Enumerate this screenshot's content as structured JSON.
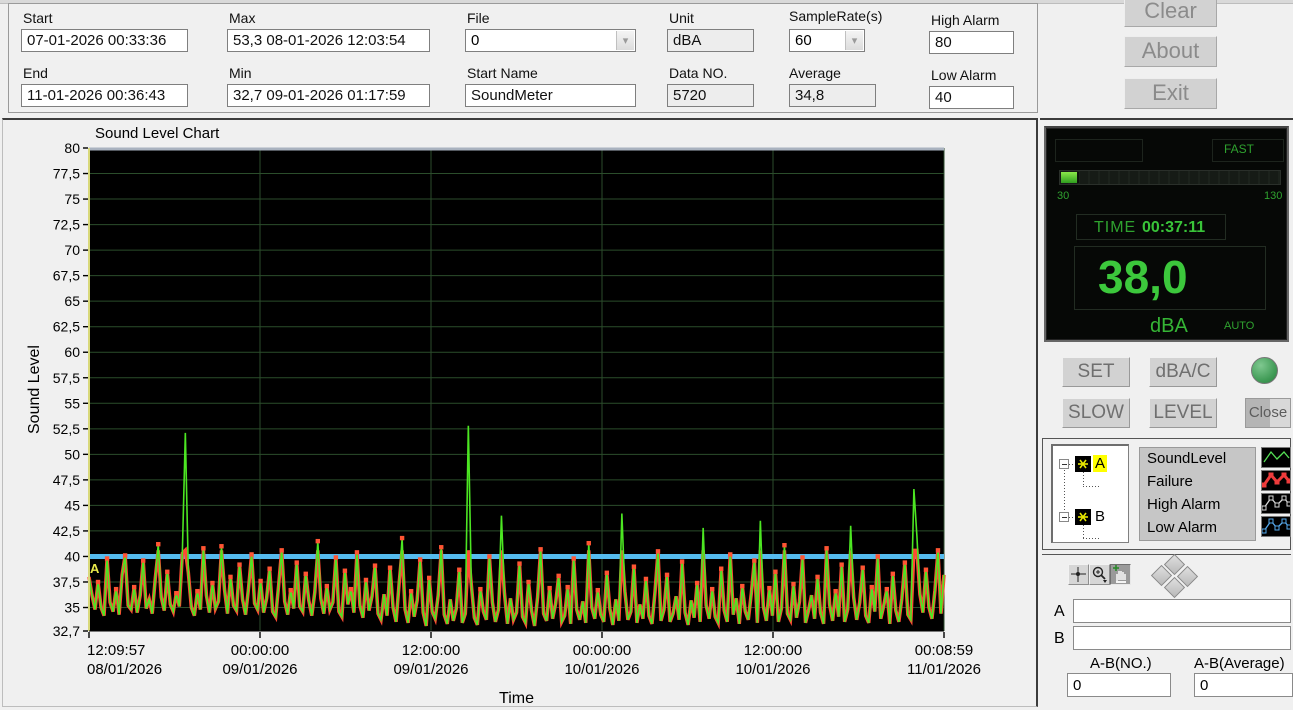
{
  "toolbar": {
    "start": {
      "label": "Start",
      "value": "07-01-2026 00:33:36"
    },
    "end": {
      "label": "End",
      "value": "11-01-2026 00:36:43"
    },
    "max": {
      "label": "Max",
      "value": "53,3 08-01-2026 12:03:54"
    },
    "min": {
      "label": "Min",
      "value": "32,7 09-01-2026 01:17:59"
    },
    "file": {
      "label": "File",
      "value": "0"
    },
    "start_name": {
      "label": "Start Name",
      "value": "SoundMeter"
    },
    "unit": {
      "label": "Unit",
      "value": "dBA"
    },
    "data_no": {
      "label": "Data NO.",
      "value": "5720"
    },
    "sample_rate": {
      "label": "SampleRate(s)",
      "value": "60"
    },
    "average": {
      "label": "Average",
      "value": "34,8"
    },
    "high_alarm": {
      "label": "High Alarm",
      "value": "80"
    },
    "low_alarm": {
      "label": "Low Alarm",
      "value": "40"
    },
    "buttons": {
      "clear": "Clear",
      "about": "About",
      "exit": "Exit"
    }
  },
  "meter": {
    "mode": "FAST",
    "bar": {
      "min": 30,
      "max": 130,
      "value": 38,
      "min_label": "30",
      "max_label": "130"
    },
    "time_label": "TIME",
    "time_value": "00:37:11",
    "value": "38,0",
    "unit": "dBA",
    "range_mode": "AUTO",
    "buttons": {
      "set": "SET",
      "dbac": "dBA/C",
      "slow": "SLOW",
      "level": "LEVEL",
      "close": "Close"
    }
  },
  "legend": {
    "tree": {
      "a": "A",
      "b": "B"
    },
    "items": [
      {
        "label": "SoundLevel",
        "color": "#55e055",
        "style": "plain"
      },
      {
        "label": "Failure",
        "color": "#ee3b3b",
        "style": "thick"
      },
      {
        "label": "High Alarm",
        "color": "#d8d8d8",
        "style": "open"
      },
      {
        "label": "Low Alarm",
        "color": "#55aaee",
        "style": "open"
      }
    ]
  },
  "analysis": {
    "a_label": "A",
    "b_label": "B",
    "a_value": "",
    "b_value": "",
    "ab_no": {
      "label": "A-B(NO.)",
      "value": "0"
    },
    "ab_avg": {
      "label": "A-B(Average)",
      "value": "0"
    }
  },
  "chart_data": {
    "type": "line",
    "title": "Sound Level Chart",
    "xlabel": "Time",
    "ylabel": "Sound Level",
    "ylim": [
      32.7,
      80
    ],
    "grid": true,
    "colors": {
      "plot_bg": "#000000",
      "grid": "#2b4d2b",
      "axis_left": "#d8d87a",
      "series": "#4ce622",
      "failure": "#ff4a33",
      "marker": "#ff5533",
      "low_alarm_line": "#55bbee",
      "high_alarm_line": "#a9b2bf",
      "cursor": "#e8e84a",
      "text": "#000000"
    },
    "low_alarm_value": 40,
    "high_alarm_value": 80,
    "cursor_a": {
      "label": "A",
      "index": 0
    },
    "y_ticks": [
      [
        80,
        "80"
      ],
      [
        77.5,
        "77,5"
      ],
      [
        75,
        "75"
      ],
      [
        72.5,
        "72,5"
      ],
      [
        70,
        "70"
      ],
      [
        67.5,
        "67,5"
      ],
      [
        65,
        "65"
      ],
      [
        62.5,
        "62,5"
      ],
      [
        60,
        "60"
      ],
      [
        57.5,
        "57,5"
      ],
      [
        55,
        "55"
      ],
      [
        52.5,
        "52,5"
      ],
      [
        50,
        "50"
      ],
      [
        47.5,
        "47,5"
      ],
      [
        45,
        "45"
      ],
      [
        42.5,
        "42,5"
      ],
      [
        40,
        "40"
      ],
      [
        37.5,
        "37,5"
      ],
      [
        35,
        "35"
      ],
      [
        32.7,
        "32,7"
      ]
    ],
    "x_ticks": [
      {
        "pos": 0.0,
        "time": "12:09:57",
        "date": "08/01/2026"
      },
      {
        "pos": 0.2,
        "time": "00:00:00",
        "date": "09/01/2026"
      },
      {
        "pos": 0.4,
        "time": "12:00:00",
        "date": "09/01/2026"
      },
      {
        "pos": 0.6,
        "time": "00:00:00",
        "date": "10/01/2026"
      },
      {
        "pos": 0.8,
        "time": "12:00:00",
        "date": "10/01/2026"
      },
      {
        "pos": 1.0,
        "time": "00:08:59",
        "date": "11/01/2026"
      }
    ],
    "series_name": "SoundLevel",
    "values": [
      38.0,
      36.2,
      34.8,
      37.5,
      35.0,
      34.2,
      39.8,
      35.5,
      34.6,
      36.8,
      34.3,
      38.2,
      40.1,
      35.2,
      34.8,
      37.0,
      34.5,
      36.2,
      39.6,
      34.9,
      35.8,
      34.4,
      37.8,
      41.2,
      36.0,
      34.7,
      38.5,
      35.3,
      34.6,
      36.4,
      35.1,
      40.3,
      52.1,
      38.4,
      35.0,
      34.2,
      36.6,
      34.8,
      40.8,
      36.2,
      34.5,
      37.4,
      34.9,
      35.6,
      41.0,
      36.8,
      34.4,
      38.0,
      35.2,
      34.7,
      39.2,
      35.8,
      34.3,
      36.9,
      40.2,
      35.4,
      34.8,
      37.6,
      34.5,
      35.9,
      38.8,
      34.6,
      34.1,
      37.2,
      40.6,
      35.6,
      34.3,
      36.7,
      34.9,
      39.4,
      35.1,
      34.6,
      38.3,
      35.7,
      34.2,
      36.5,
      41.5,
      35.9,
      34.4,
      37.1,
      34.8,
      35.5,
      39.9,
      34.6,
      34.1,
      38.6,
      35.3,
      36.8,
      34.5,
      40.4,
      35.2,
      34.0,
      37.7,
      34.7,
      36.1,
      39.1,
      34.4,
      33.8,
      36.3,
      34.2,
      38.9,
      35.0,
      33.6,
      37.3,
      41.8,
      34.8,
      33.5,
      36.6,
      34.1,
      35.7,
      39.7,
      34.5,
      33.2,
      37.9,
      34.6,
      33.9,
      36.2,
      40.9,
      34.3,
      33.4,
      35.8,
      33.7,
      34.9,
      38.7,
      33.5,
      34.4,
      52.8,
      37.2,
      34.0,
      33.3,
      36.8,
      34.6,
      33.8,
      40.0,
      35.5,
      33.6,
      34.8,
      44.0,
      36.4,
      33.4,
      35.9,
      33.8,
      34.5,
      39.3,
      34.1,
      33.5,
      37.5,
      34.7,
      33.2,
      36.0,
      40.7,
      34.4,
      33.7,
      36.9,
      33.9,
      35.4,
      38.1,
      33.6,
      34.2,
      37.0,
      33.4,
      39.8,
      34.8,
      33.8,
      35.6,
      33.5,
      41.3,
      35.0,
      33.9,
      36.7,
      34.3,
      33.6,
      38.4,
      34.9,
      33.3,
      35.8,
      33.7,
      44.2,
      36.6,
      33.8,
      34.6,
      39.0,
      33.5,
      35.3,
      33.9,
      37.8,
      34.2,
      33.4,
      36.5,
      40.5,
      33.7,
      34.8,
      38.2,
      33.6,
      34.4,
      36.1,
      33.8,
      39.5,
      34.5,
      33.3,
      35.7,
      34.0,
      37.4,
      33.6,
      42.8,
      35.2,
      33.9,
      36.8,
      34.1,
      33.5,
      38.8,
      34.7,
      33.6,
      40.2,
      34.3,
      35.9,
      33.4,
      37.1,
      34.6,
      33.8,
      36.4,
      39.6,
      33.5,
      43.5,
      35.1,
      33.7,
      36.9,
      34.2,
      38.5,
      33.6,
      34.9,
      41.1,
      34.4,
      33.8,
      37.3,
      34.0,
      35.6,
      39.9,
      33.5,
      34.7,
      36.2,
      33.9,
      38.0,
      34.5,
      33.4,
      40.8,
      35.3,
      33.7,
      36.6,
      34.1,
      39.2,
      33.6,
      34.8,
      43.0,
      36.0,
      33.8,
      35.5,
      38.9,
      34.2,
      33.5,
      37.0,
      34.6,
      40.0,
      33.9,
      35.2,
      36.8,
      33.4,
      38.3,
      34.7,
      33.6,
      35.9,
      39.4,
      34.3,
      33.8,
      46.6,
      42.0,
      36.3,
      34.5,
      38.7,
      35.0,
      33.9,
      36.7,
      40.6,
      34.4,
      38.2
    ]
  }
}
